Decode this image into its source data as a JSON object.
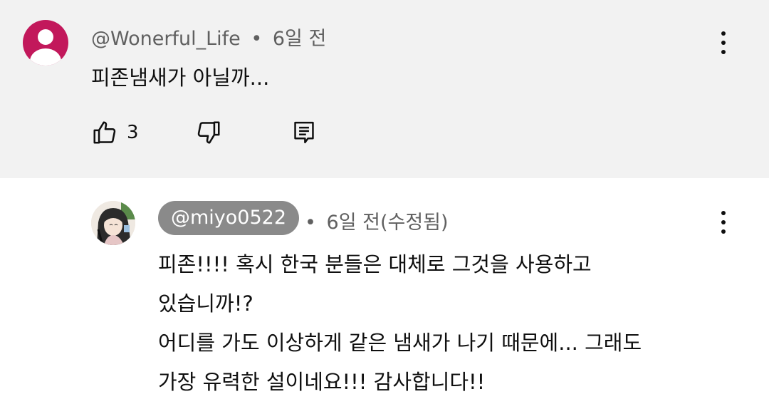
{
  "comment": {
    "author": "@Wonerful_Life",
    "separator": "•",
    "time": "6일 전",
    "text": "피존냄새가 아닐까...",
    "like_count": "3",
    "avatar_color": "#c2185b",
    "icons": [
      "like-icon",
      "dislike-icon",
      "reply-icon",
      "more-icon"
    ]
  },
  "reply": {
    "author": "@miyo0522",
    "separator": "•",
    "time": "6일 전(수정됨)",
    "lines": [
      "피존!!!! 혹시 한국 분들은 대체로 그것을 사용하고",
      "있습니까!?",
      "어디를 가도 이상하게 같은 냄새가 나기 때문에... 그래도",
      "가장 유력한 설이네요!!! 감사합니다!!"
    ],
    "chip_color": "#8a8a8a"
  },
  "colors": {
    "top_bg": "#f2f2f2",
    "meta_text": "#606060",
    "body_text": "#0f0f0f"
  }
}
